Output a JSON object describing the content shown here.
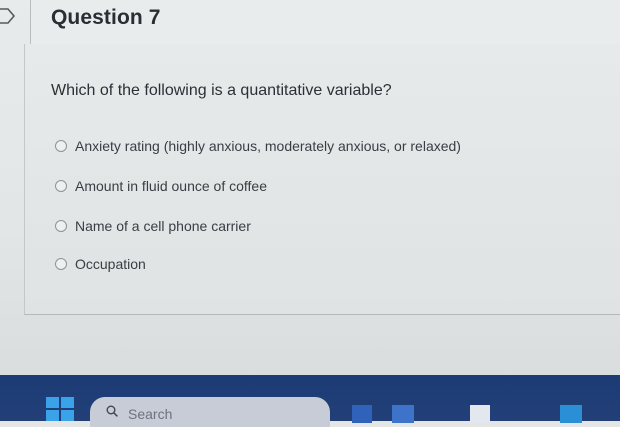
{
  "question": {
    "title": "Question 7",
    "prompt": "Which of the following is a quantitative variable?",
    "options": [
      {
        "label": "Anxiety rating (highly anxious, moderately anxious, or relaxed)"
      },
      {
        "label": "Amount in fluid ounce of coffee"
      },
      {
        "label": "Name of a cell phone carrier"
      },
      {
        "label": "Occupation"
      }
    ]
  },
  "taskbar": {
    "search_placeholder": "Search",
    "start_icon": "windows-start-icon",
    "search_icon": "magnifier-icon"
  },
  "colors": {
    "page_background": "#e4e6e6",
    "taskbar": "#1c3b74",
    "start_tile": "#3aa2e8"
  }
}
